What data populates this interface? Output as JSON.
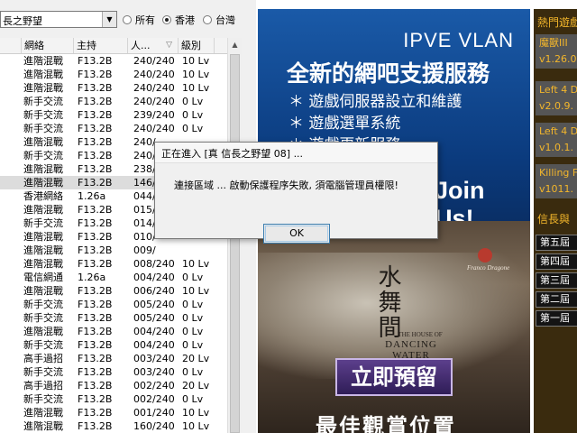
{
  "toolbar": {
    "game_select_value": "長之野望",
    "filter_options": [
      {
        "label": "所有",
        "checked": false
      },
      {
        "label": "香港",
        "checked": true
      },
      {
        "label": "台灣",
        "checked": false
      }
    ]
  },
  "table": {
    "headers": [
      "網絡",
      "主持",
      "人...",
      "級別"
    ],
    "sort_indicator": "▽",
    "rows": [
      {
        "net": "進階混戰",
        "host": "F13.2B",
        "players": "240/240",
        "level": "10 Lv"
      },
      {
        "net": "進階混戰",
        "host": "F13.2B",
        "players": "240/240",
        "level": "10 Lv"
      },
      {
        "net": "進階混戰",
        "host": "F13.2B",
        "players": "240/240",
        "level": "10 Lv"
      },
      {
        "net": "新手交流",
        "host": "F13.2B",
        "players": "240/240",
        "level": "0 Lv"
      },
      {
        "net": "新手交流",
        "host": "F13.2B",
        "players": "239/240",
        "level": "0 Lv"
      },
      {
        "net": "新手交流",
        "host": "F13.2B",
        "players": "240/240",
        "level": "0 Lv"
      },
      {
        "net": "進階混戰",
        "host": "F13.2B",
        "players": "240/",
        "level": ""
      },
      {
        "net": "新手交流",
        "host": "F13.2B",
        "players": "240/",
        "level": ""
      },
      {
        "net": "進階混戰",
        "host": "F13.2B",
        "players": "238/",
        "level": ""
      },
      {
        "net": "進階混戰",
        "host": "F13.2B",
        "players": "146/",
        "level": ""
      },
      {
        "net": "香港網絡",
        "host": "1.26a",
        "players": "044/",
        "level": ""
      },
      {
        "net": "進階混戰",
        "host": "F13.2B",
        "players": "015/",
        "level": ""
      },
      {
        "net": "新手交流",
        "host": "F13.2B",
        "players": "014/",
        "level": ""
      },
      {
        "net": "進階混戰",
        "host": "F13.2B",
        "players": "010/",
        "level": ""
      },
      {
        "net": "進階混戰",
        "host": "F13.2B",
        "players": "009/",
        "level": ""
      },
      {
        "net": "進階混戰",
        "host": "F13.2B",
        "players": "008/240",
        "level": "10 Lv"
      },
      {
        "net": "電信網通",
        "host": "1.26a",
        "players": "004/240",
        "level": "0 Lv"
      },
      {
        "net": "進階混戰",
        "host": "F13.2B",
        "players": "006/240",
        "level": "10 Lv"
      },
      {
        "net": "新手交流",
        "host": "F13.2B",
        "players": "005/240",
        "level": "0 Lv"
      },
      {
        "net": "新手交流",
        "host": "F13.2B",
        "players": "005/240",
        "level": "0 Lv"
      },
      {
        "net": "進階混戰",
        "host": "F13.2B",
        "players": "004/240",
        "level": "0 Lv"
      },
      {
        "net": "新手交流",
        "host": "F13.2B",
        "players": "004/240",
        "level": "0 Lv"
      },
      {
        "net": "高手過招",
        "host": "F13.2B",
        "players": "003/240",
        "level": "20 Lv"
      },
      {
        "net": "新手交流",
        "host": "F13.2B",
        "players": "003/240",
        "level": "0 Lv"
      },
      {
        "net": "高手過招",
        "host": "F13.2B",
        "players": "002/240",
        "level": "20 Lv"
      },
      {
        "net": "新手交流",
        "host": "F13.2B",
        "players": "002/240",
        "level": "0 Lv"
      },
      {
        "net": "進階混戰",
        "host": "F13.2B",
        "players": "001/240",
        "level": "10 Lv"
      },
      {
        "net": "進階混戰",
        "host": "F13.2B",
        "players": "160/240",
        "level": "10 Lv"
      }
    ],
    "selected_row": 9
  },
  "banner": {
    "brand": "IPVE VLAN",
    "headline": "全新的網吧支援服務",
    "bullets": [
      "遊戲伺服器設立和維護",
      "遊戲選單系統",
      "遊戲更新服務"
    ],
    "join": "Join Us!",
    "calligraphy": "水舞間",
    "show_small": "THE HOUSE OF",
    "show_name_1": "DANCING",
    "show_name_2": "WATER",
    "presenter": "Franco Dragone",
    "book_now": "立即預留",
    "best_seat": "最佳觀賞位置"
  },
  "hot_panel": {
    "title": "熱門遊戲",
    "items": [
      {
        "line1": "魔獸III",
        "line2": "v1.26.0"
      },
      {
        "line1": "Left 4 D",
        "line2": "v2.0.9."
      },
      {
        "line1": "Left 4 D",
        "line2": "v1.0.1."
      },
      {
        "line1": "Killing F",
        "line2": "v1011."
      }
    ],
    "section_title": "信長與",
    "links": [
      "第五屆",
      "第四屆",
      "第三屆",
      "第二屆",
      "第一屆"
    ]
  },
  "dialog": {
    "title": "正在進入 [真 信長之野望 08] ...",
    "message": "連接區域 ... 啟動保護程序失敗, 須電腦管理員權限!",
    "ok_label": "OK"
  },
  "colors": {
    "banner_blue": "#0d3f83",
    "hot_panel_bg": "#3a2b0e",
    "hot_gold": "#f3b62b",
    "selected_row": "#dcdcdc"
  }
}
